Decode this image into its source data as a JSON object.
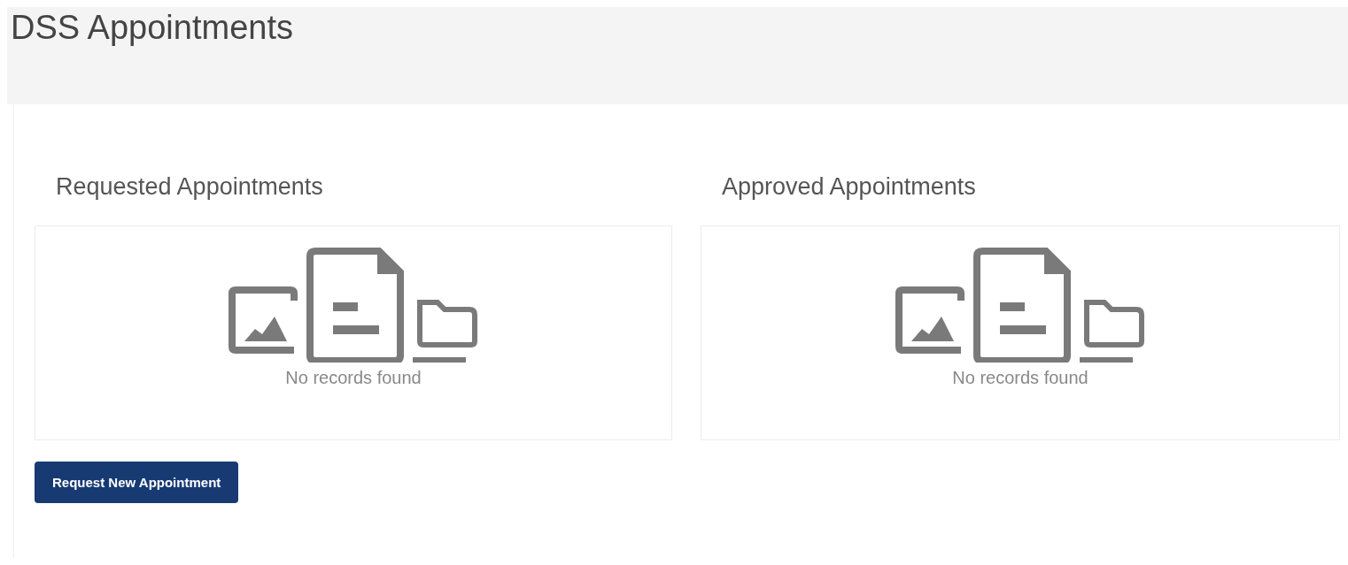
{
  "page": {
    "title": "DSS Appointments"
  },
  "panels": [
    {
      "title": "Requested Appointments",
      "empty_message": "No records found"
    },
    {
      "title": "Approved Appointments",
      "empty_message": "No records found"
    }
  ],
  "buttons": [
    {
      "label": "Request New Appointment"
    }
  ]
}
